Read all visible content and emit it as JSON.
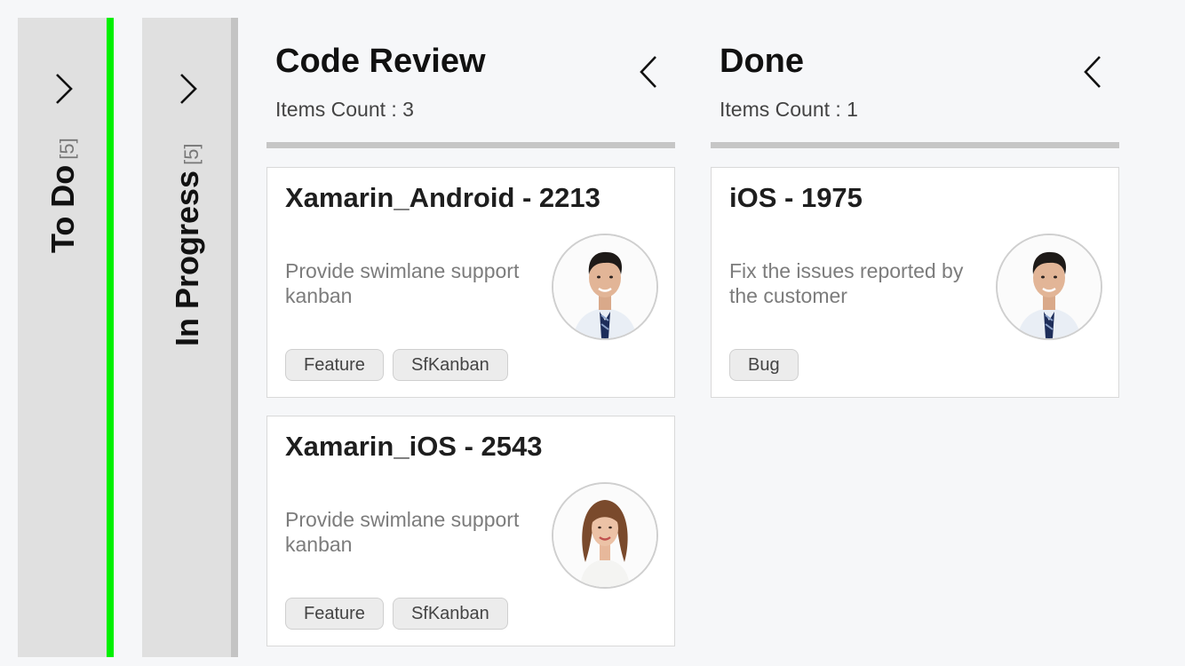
{
  "collapsed_columns": [
    {
      "title": "To Do",
      "count": "[5]"
    },
    {
      "title": "In Progress",
      "count": "[5]"
    }
  ],
  "columns": [
    {
      "title": "Code Review",
      "items_count": "Items Count : 3",
      "cards": [
        {
          "title": "Xamarin_Android - 2213",
          "description": "Provide swimlane support kanban",
          "avatar": "male-avatar",
          "tags": [
            "Feature",
            "SfKanban"
          ]
        },
        {
          "title": "Xamarin_iOS - 2543",
          "description": "Provide swimlane support kanban",
          "avatar": "female-avatar",
          "tags": [
            "Feature",
            "SfKanban"
          ]
        }
      ]
    },
    {
      "title": "Done",
      "items_count": "Items Count : 1",
      "cards": [
        {
          "title": "iOS - 1975",
          "description": "Fix the issues reported by the customer",
          "avatar": "male-avatar",
          "tags": [
            "Bug"
          ]
        }
      ]
    }
  ],
  "icons": {
    "expand": "chevron-right-icon",
    "collapse": "chevron-left-icon"
  },
  "colors": {
    "todo_stripe": "#00f000",
    "progress_stripe": "#c4c4c4",
    "background": "#f6f7f9"
  }
}
